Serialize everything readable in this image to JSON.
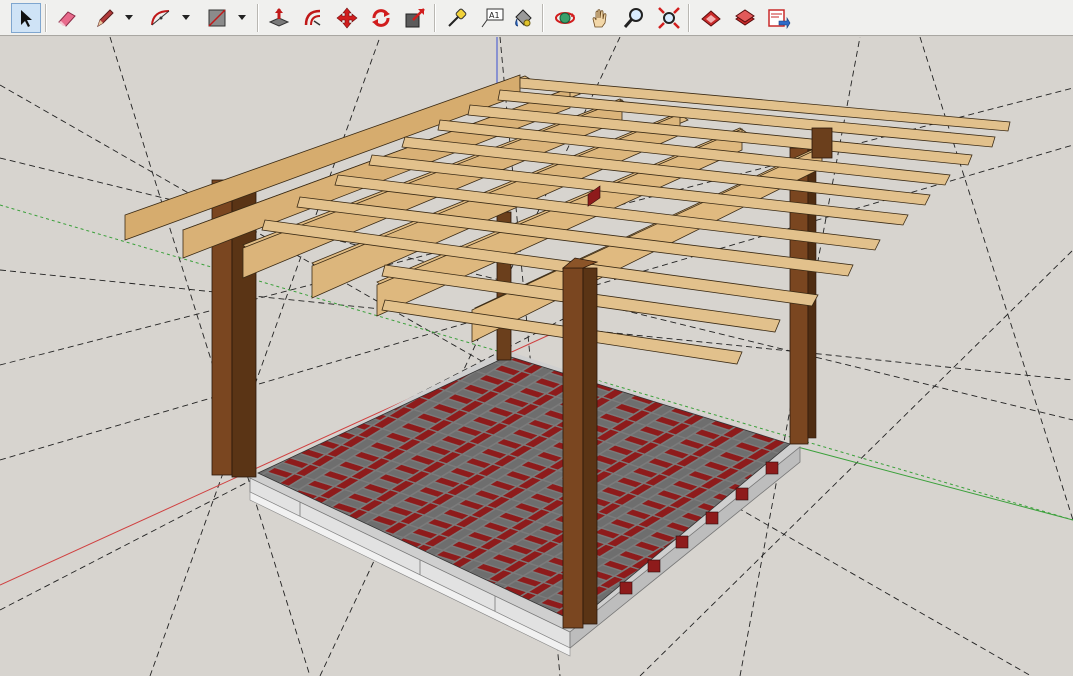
{
  "toolbar": {
    "tools": [
      {
        "name": "select-icon",
        "active": true
      },
      {
        "name": "eraser-icon"
      },
      {
        "name": "pencil-icon",
        "dropdown": true
      },
      {
        "name": "arc-icon",
        "dropdown": true
      },
      {
        "name": "rectangle-icon",
        "dropdown": true
      },
      {
        "name": "push-pull-icon"
      },
      {
        "name": "offset-icon"
      },
      {
        "name": "move-icon"
      },
      {
        "name": "rotate-icon"
      },
      {
        "name": "scale-icon"
      },
      {
        "name": "tape-measure-icon"
      },
      {
        "name": "text-label-icon"
      },
      {
        "name": "paint-bucket-icon"
      },
      {
        "name": "orbit-icon"
      },
      {
        "name": "pan-icon"
      },
      {
        "name": "zoom-icon"
      },
      {
        "name": "zoom-extents-icon"
      },
      {
        "name": "warehouse-icon"
      },
      {
        "name": "components-icon"
      },
      {
        "name": "share-model-icon"
      }
    ],
    "text_label_glyph": "A1"
  },
  "colors": {
    "ground": "#d7d4cf",
    "post": "#6b3f1c",
    "beam": "#d8b27a",
    "brick": "#8c1a1a",
    "paver": "#7a7a7a",
    "slab": "#d9d9d9",
    "axis_red": "#d04040",
    "axis_green": "#3aa03a",
    "axis_blue": "#3b4fd0"
  }
}
